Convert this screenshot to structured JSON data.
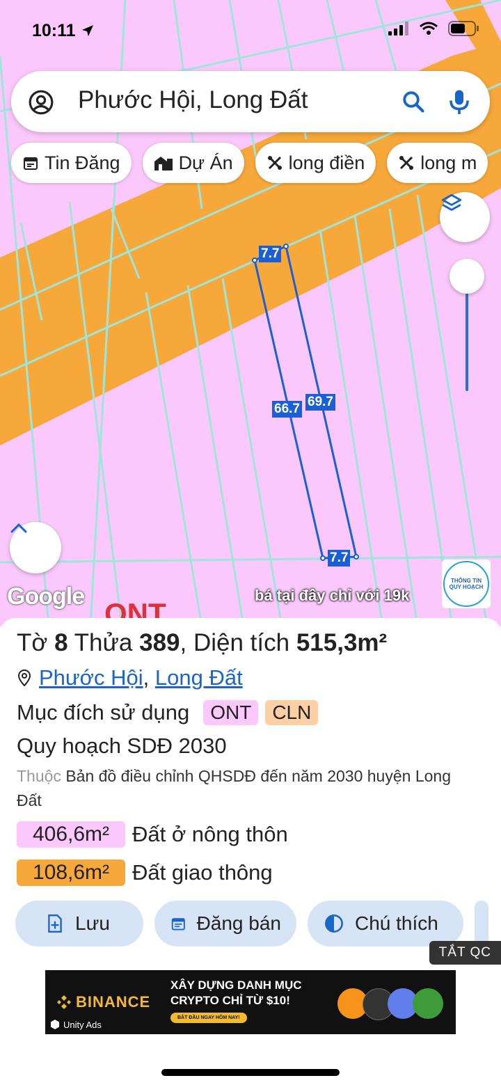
{
  "status_bar": {
    "time": "10:11"
  },
  "search": {
    "text": "Phước Hội, Long Đất"
  },
  "chips": [
    {
      "label": "Tin Đăng",
      "icon": "calendar-icon"
    },
    {
      "label": "Dự Án",
      "icon": "buildings-icon"
    },
    {
      "label": "long điền",
      "icon": "tool-icon"
    },
    {
      "label": "long m",
      "icon": "tool-icon"
    }
  ],
  "map": {
    "measurements": {
      "top": "7.7",
      "left_side": "66.7",
      "right_side": "69.7",
      "bottom": "7.7"
    },
    "attribution": "Google",
    "ad_caption": "bá tại đây chỉ với 19k",
    "zone_label": "ONT",
    "logo_text": [
      "THÔNG TIN",
      "QUY HOẠCH"
    ],
    "colors": {
      "residential": "#fbc8fb",
      "road": "#f7a83a",
      "parcel_outline": "#1a5fd6"
    }
  },
  "parcel": {
    "title_pre": "Tờ",
    "sheet": "8",
    "title_mid": "Thửa",
    "lot": "389",
    "area_label": ", Diện tích",
    "area": "515,3m²",
    "ward": "Phước Hội",
    "district": "Long Đất",
    "purpose_label": "Mục đích sử dụng",
    "purpose_tags": [
      "ONT",
      "CLN"
    ],
    "plan_label": "Quy hoạch SDĐ 2030",
    "belongs_prefix": "Thuộc",
    "belongs_text": "Bản đồ điều chỉnh QHSDĐ đến năm 2030 huyện Long Đất",
    "areas": [
      {
        "value": "406,6m²",
        "label": "Đất ở nông thôn",
        "color": "#fbc8fb"
      },
      {
        "value": "108,6m²",
        "label": "Đất giao thông",
        "color": "#f7a83a"
      }
    ]
  },
  "actions": [
    {
      "label": "Lưu",
      "icon": "add-file-icon"
    },
    {
      "label": "Đăng bán",
      "icon": "calendar-icon"
    },
    {
      "label": "Chú thích",
      "icon": "contrast-icon"
    }
  ],
  "ad_close": "TẮT QC",
  "ad_banner": {
    "brand": "BINANCE",
    "headline_1": "XÂY DỰNG DANH MỤC",
    "headline_2": "CRYPTO CHỈ TỪ $10!",
    "cta": "BẮT ĐẦU NGAY HÔM NAY!",
    "network": "Unity Ads"
  }
}
